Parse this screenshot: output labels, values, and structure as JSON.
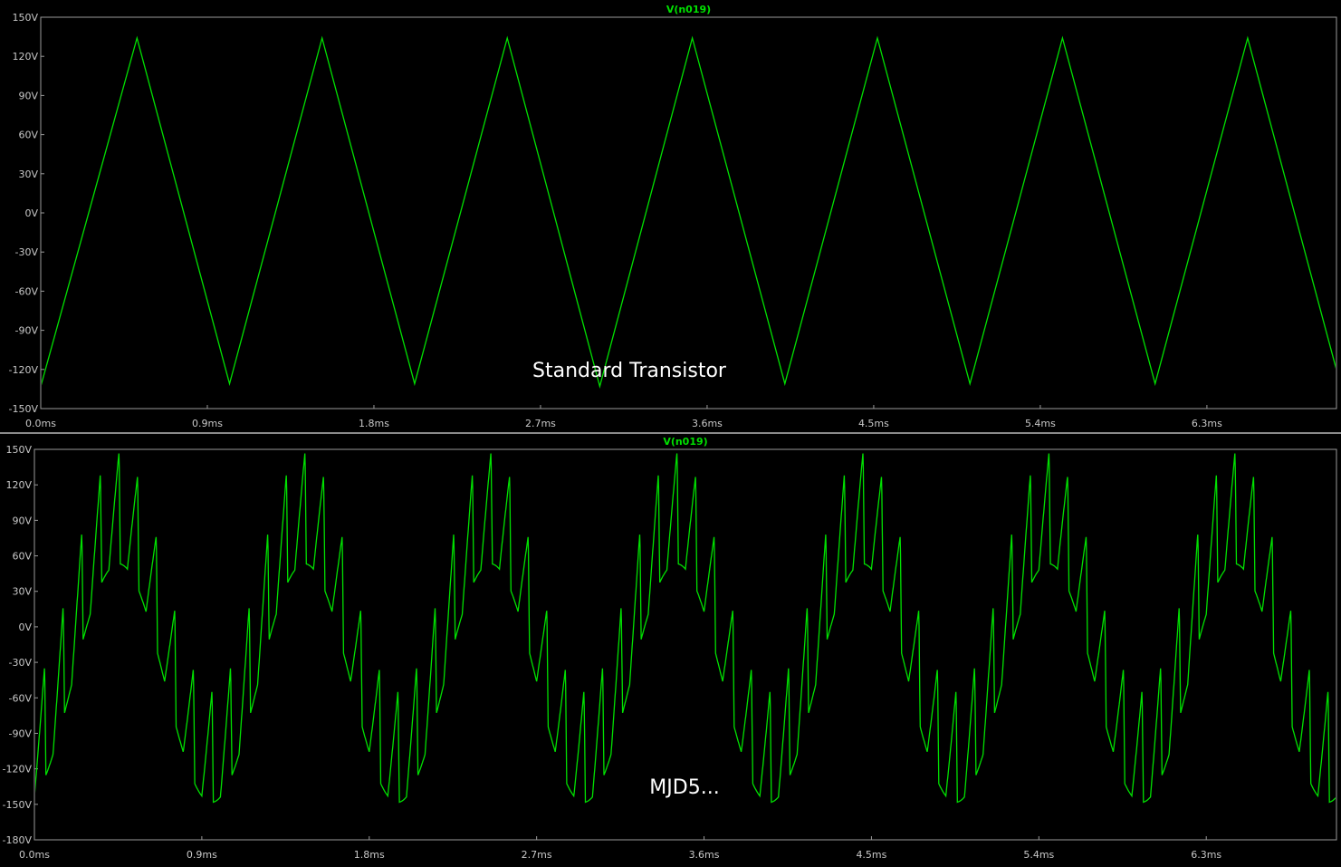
{
  "chart_data": [
    {
      "type": "line",
      "title": "V(n019)",
      "annotation": "Standard Transistor",
      "xlabel": "",
      "ylabel": "",
      "xlim": [
        0,
        7.0
      ],
      "ylim": [
        -150,
        150
      ],
      "x_ticks": [
        "0.0ms",
        "0.9ms",
        "1.8ms",
        "2.7ms",
        "3.6ms",
        "4.5ms",
        "5.4ms",
        "6.3ms"
      ],
      "y_ticks": [
        "150V",
        "120V",
        "90V",
        "60V",
        "30V",
        "0V",
        "-30V",
        "-60V",
        "-90V",
        "-120V",
        "-150V"
      ],
      "grid": false,
      "line_color": "#00e000",
      "series": [
        {
          "x": [
            0.0,
            0.52,
            1.02,
            1.52,
            2.02,
            2.52,
            3.02,
            3.52,
            4.02,
            4.52,
            5.02,
            5.52,
            6.02,
            6.52,
            7.02
          ],
          "y": [
            -133,
            134,
            -131,
            134,
            -131,
            134,
            -133,
            134,
            -131,
            134,
            -131,
            134,
            -131,
            134,
            -131
          ]
        }
      ]
    },
    {
      "type": "line",
      "title": "V(n019)",
      "annotation": "MJD5...",
      "xlabel": "",
      "ylabel": "",
      "xlim": [
        0,
        7.0
      ],
      "ylim": [
        -180,
        150
      ],
      "x_ticks": [
        "0.0ms",
        "0.9ms",
        "1.8ms",
        "2.7ms",
        "3.6ms",
        "4.5ms",
        "5.4ms",
        "6.3ms"
      ],
      "y_ticks": [
        "150V",
        "120V",
        "90V",
        "60V",
        "30V",
        "0V",
        "-30V",
        "-60V",
        "-90V",
        "-120V",
        "-150V",
        "-180V"
      ],
      "grid": false,
      "line_color": "#00e000",
      "fundamental_period_ms": 1.0,
      "fundamental_amplitude_v": 140,
      "ripple_period_ms": 0.1,
      "ripple_peak_to_peak_v": 95
    }
  ]
}
